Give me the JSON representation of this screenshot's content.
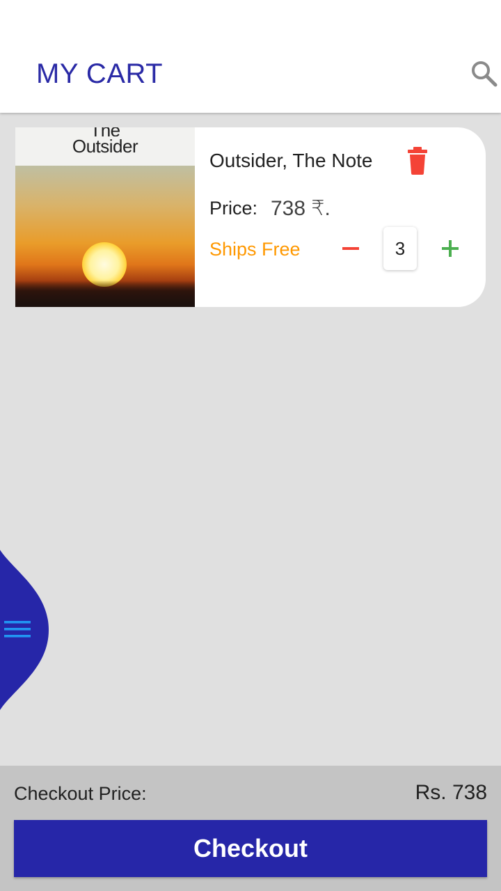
{
  "app_bar": {
    "title": "MY CART",
    "search_icon": "search-icon"
  },
  "cart_items": [
    {
      "cover_text": "The\nOutsider",
      "title": "Outsider, The Note",
      "price_label": "Price:",
      "price": "738 ₹.",
      "shipping": "Ships Free",
      "quantity": "3",
      "delete_icon": "trash-icon",
      "decrement_icon": "minus-icon",
      "increment_icon": "plus-icon"
    }
  ],
  "side_menu": {
    "icon": "menu-icon"
  },
  "checkout": {
    "label": "Checkout Price:",
    "total": "Rs. 738",
    "button_label": "Checkout"
  },
  "colors": {
    "primary": "#2626a8",
    "accent_orange": "#ff9800",
    "delete_red": "#f44336",
    "plus_green": "#4caf50",
    "menu_icon_blue": "#2196f3",
    "background": "#e0e0e0"
  }
}
